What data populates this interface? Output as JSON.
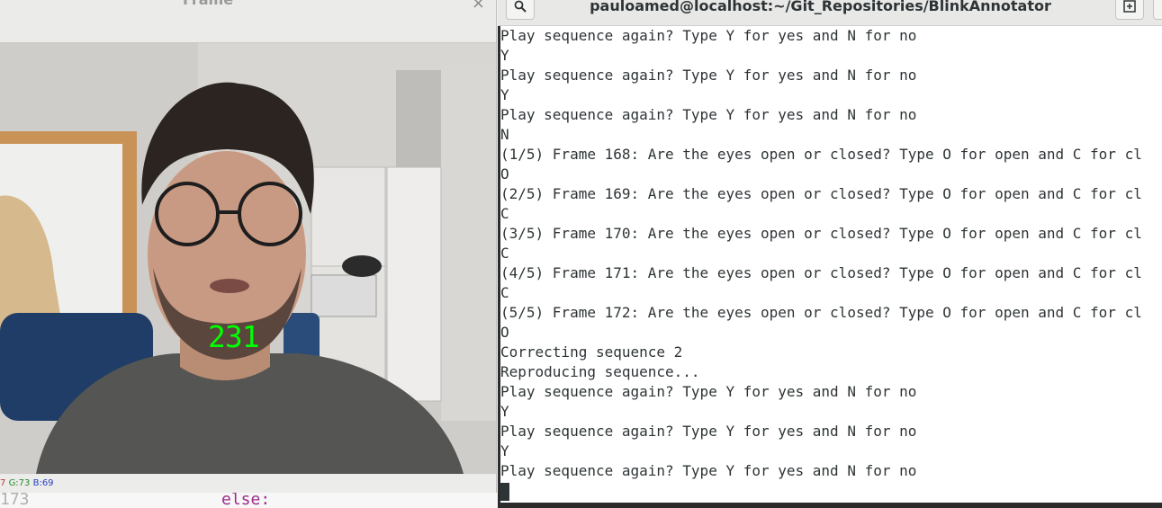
{
  "frame_window": {
    "title": "Frame",
    "close_glyph": "×",
    "frame_counter": "231",
    "pixel_status": {
      "r": "7",
      "g": "G:73",
      "b": "B:69"
    }
  },
  "editor": {
    "line_number": "173",
    "code": "else:"
  },
  "terminal": {
    "title": "pauloamed@localhost:~/Git_Repositories/BlinkAnnotator",
    "search_icon": "search-icon",
    "new_tab_icon": "new-tab-icon",
    "lines": [
      "Play sequence again? Type Y for yes and N for no",
      "Y",
      "Play sequence again? Type Y for yes and N for no",
      "Y",
      "Play sequence again? Type Y for yes and N for no",
      "N",
      "(1/5) Frame 168: Are the eyes open or closed? Type O for open and C for cl",
      "O",
      "(2/5) Frame 169: Are the eyes open or closed? Type O for open and C for cl",
      "C",
      "(3/5) Frame 170: Are the eyes open or closed? Type O for open and C for cl",
      "C",
      "(4/5) Frame 171: Are the eyes open or closed? Type O for open and C for cl",
      "C",
      "(5/5) Frame 172: Are the eyes open or closed? Type O for open and C for cl",
      "O",
      "Correcting sequence 2",
      "Reproducing sequence...",
      "Play sequence again? Type Y for yes and N for no",
      "Y",
      "Play sequence again? Type Y for yes and N for no",
      "Y",
      "Play sequence again? Type Y for yes and N for no"
    ]
  }
}
